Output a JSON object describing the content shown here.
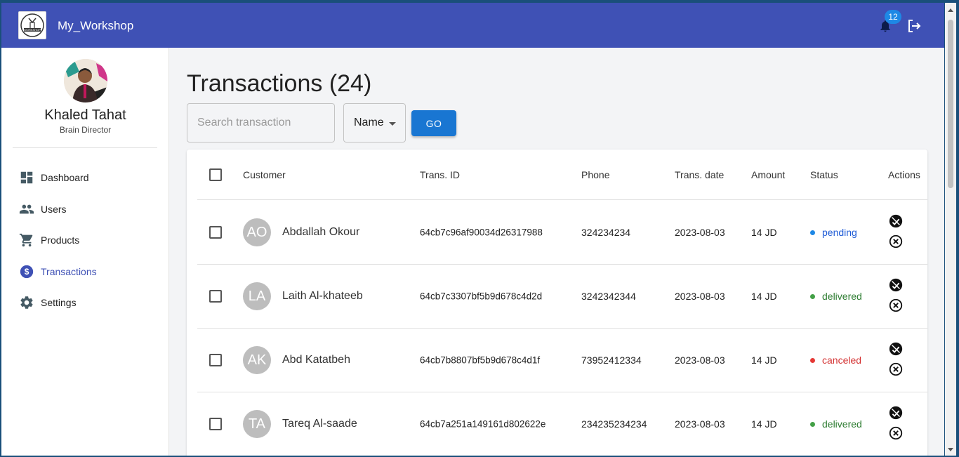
{
  "header": {
    "logo_text": "WORKSHOP",
    "brand": "My_Workshop",
    "notifications_count": "12"
  },
  "user": {
    "name": "Khaled Tahat",
    "role": "Brain Director"
  },
  "nav": [
    {
      "label": "Dashboard",
      "icon": "dashboard-icon"
    },
    {
      "label": "Users",
      "icon": "users-icon"
    },
    {
      "label": "Products",
      "icon": "cart-icon"
    },
    {
      "label": "Transactions",
      "icon": "dollar-icon",
      "active": true
    },
    {
      "label": "Settings",
      "icon": "gear-icon"
    }
  ],
  "page": {
    "title": "Transactions (24)",
    "search_placeholder": "Search transaction",
    "filter_selected": "Name",
    "go_label": "GO"
  },
  "table": {
    "columns": [
      "Customer",
      "Trans. ID",
      "Phone",
      "Trans. date",
      "Amount",
      "Status",
      "Actions"
    ],
    "rows": [
      {
        "initials": "AO",
        "customer": "Abdallah Okour",
        "id": "64cb7c96af90034d26317988",
        "phone": "324234234",
        "date": "2023-08-03",
        "amount": "14 JD",
        "status": "pending",
        "status_color": "#1e5bd6",
        "dot_color": "#1e88e5"
      },
      {
        "initials": "LA",
        "customer": "Laith Al-khateeb",
        "id": "64cb7c3307bf5b9d678c4d2d",
        "phone": "3242342344",
        "date": "2023-08-03",
        "amount": "14 JD",
        "status": "delivered",
        "status_color": "#2e7d32",
        "dot_color": "#43a047"
      },
      {
        "initials": "AK",
        "customer": "Abd Katatbeh",
        "id": "64cb7b8807bf5b9d678c4d1f",
        "phone": "73952412334",
        "date": "2023-08-03",
        "amount": "14 JD",
        "status": "canceled",
        "status_color": "#d32f2f",
        "dot_color": "#e53935"
      },
      {
        "initials": "TA",
        "customer": "Tareq Al-saade",
        "id": "64cb7a251a149161d802622e",
        "phone": "234235234234",
        "date": "2023-08-03",
        "amount": "14 JD",
        "status": "delivered",
        "status_color": "#2e7d32",
        "dot_color": "#43a047"
      }
    ]
  }
}
